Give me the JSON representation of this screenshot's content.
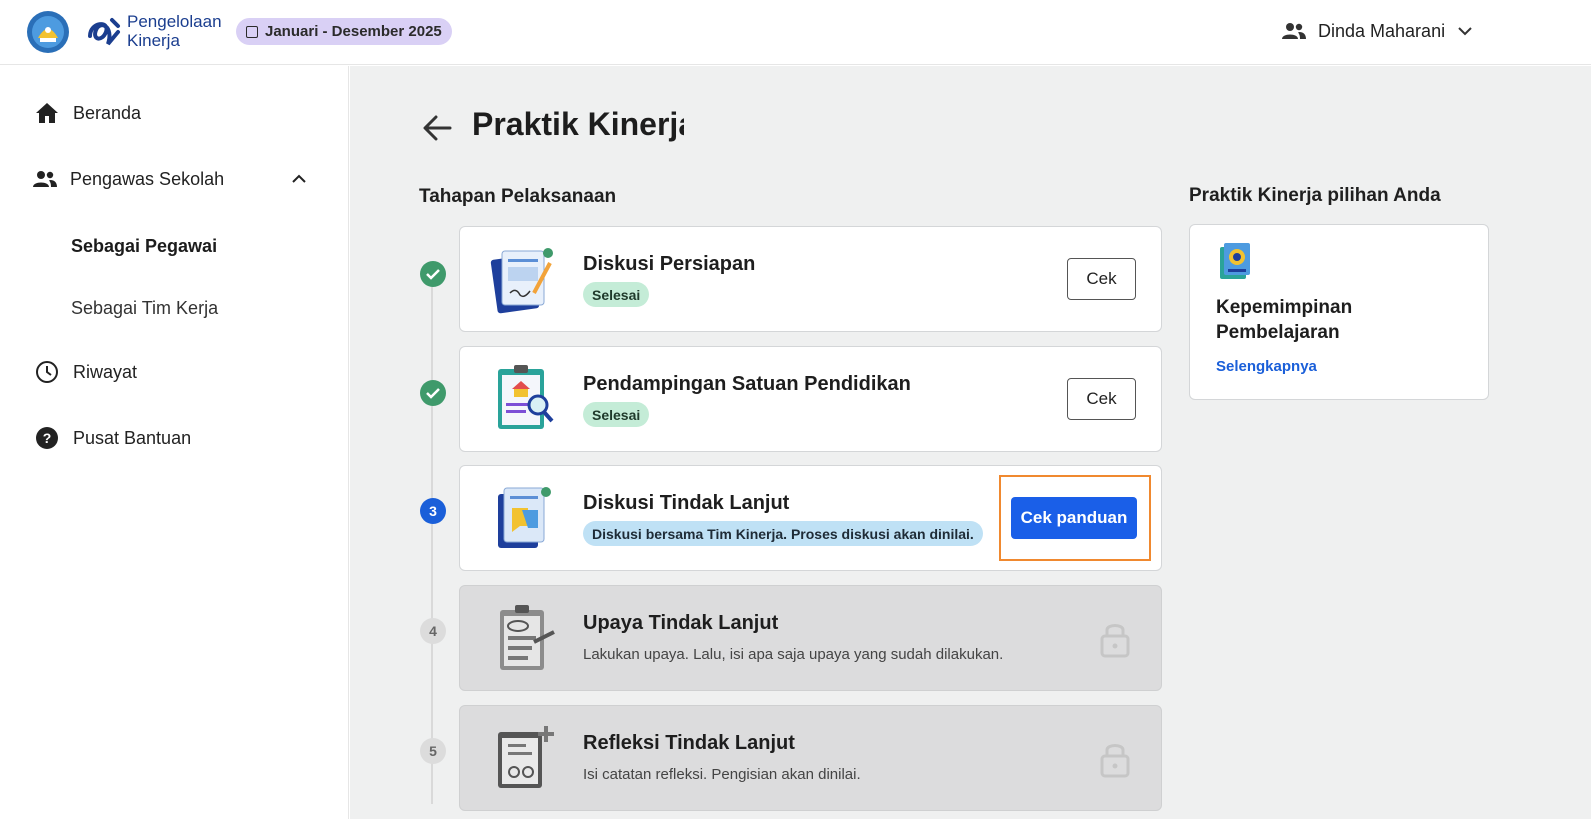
{
  "header": {
    "brand_line1": "Pengelolaan",
    "brand_line2": "Kinerja",
    "period": "Januari - Desember 2025",
    "user_name": "Dinda Maharani"
  },
  "sidebar": {
    "items": [
      {
        "label": "Beranda",
        "icon": "home-icon"
      },
      {
        "label": "Pengawas Sekolah",
        "icon": "people-icon"
      },
      {
        "label": "Riwayat",
        "icon": "clock-icon"
      },
      {
        "label": "Pusat Bantuan",
        "icon": "help-icon"
      }
    ],
    "sub_items": [
      {
        "label": "Sebagai Pegawai",
        "active": true
      },
      {
        "label": "Sebagai Tim Kerja",
        "active": false
      }
    ]
  },
  "main": {
    "page_title": "Praktik Kinerja",
    "stages_title": "Tahapan Pelaksanaan",
    "choice_title": "Praktik Kinerja pilihan Anda",
    "steps": [
      {
        "number": "1",
        "state": "done",
        "title": "Diskusi Persiapan",
        "badge": "Selesai",
        "button": "Cek"
      },
      {
        "number": "2",
        "state": "done",
        "title": "Pendampingan Satuan Pendidikan",
        "badge": "Selesai",
        "button": "Cek"
      },
      {
        "number": "3",
        "state": "active",
        "title": "Diskusi Tindak Lanjut",
        "badge": "Diskusi bersama Tim Kinerja. Proses diskusi akan dinilai.",
        "button": "Cek panduan"
      },
      {
        "number": "4",
        "state": "locked",
        "title": "Upaya Tindak Lanjut",
        "description": "Lakukan upaya. Lalu, isi apa saja upaya yang sudah dilakukan."
      },
      {
        "number": "5",
        "state": "locked",
        "title": "Refleksi Tindak Lanjut",
        "description": "Isi catatan refleksi. Pengisian akan dinilai."
      }
    ],
    "choice": {
      "title": "Kepemimpinan Pembelajaran",
      "link": "Selengkapnya"
    }
  },
  "colors": {
    "primary": "#1a5fe8",
    "success": "#3f9a6b",
    "highlight": "#f0892f",
    "period_bg": "#d9d0f5"
  }
}
